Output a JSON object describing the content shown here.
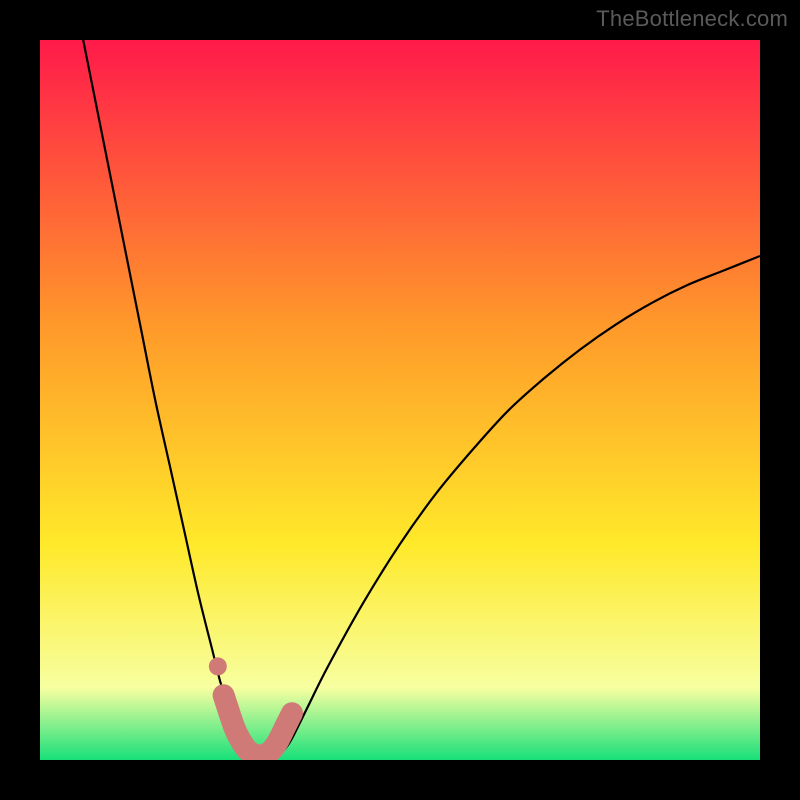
{
  "watermark": "TheBottleneck.com",
  "chart_data": {
    "type": "line",
    "title": "",
    "xlabel": "",
    "ylabel": "",
    "xlim": [
      0,
      100
    ],
    "ylim": [
      0,
      100
    ],
    "background_gradient": {
      "top": "#ff1a4a",
      "mid1": "#ff9a2a",
      "mid2": "#ffe92a",
      "mid3": "#f7ffa0",
      "bottom": "#18e07a"
    },
    "series": [
      {
        "name": "curve",
        "color": "#000000",
        "x": [
          6,
          8,
          10,
          12,
          14,
          16,
          18,
          20,
          22,
          24,
          25,
          26,
          27,
          28,
          29,
          30,
          31,
          32,
          33,
          34,
          35,
          37,
          40,
          45,
          50,
          55,
          60,
          65,
          70,
          75,
          80,
          85,
          90,
          95,
          100
        ],
        "y": [
          100,
          90,
          80,
          70,
          60,
          50,
          41,
          32,
          23,
          15,
          11,
          8,
          5,
          3,
          1.5,
          0.8,
          0.5,
          0.5,
          0.8,
          1.5,
          3,
          7,
          13,
          22,
          30,
          37,
          43,
          48.5,
          53,
          57,
          60.5,
          63.5,
          66,
          68,
          70
        ]
      },
      {
        "name": "highlight-band",
        "color": "#d07a78",
        "x": [
          25.5,
          27,
          28,
          29,
          30,
          31,
          32,
          33,
          34,
          35
        ],
        "y": [
          9,
          4.5,
          2.5,
          1.2,
          0.7,
          0.7,
          1.2,
          2.5,
          4.5,
          6.5
        ]
      },
      {
        "name": "highlight-dot",
        "color": "#d07a78",
        "x": [
          24.7
        ],
        "y": [
          13
        ]
      }
    ]
  }
}
